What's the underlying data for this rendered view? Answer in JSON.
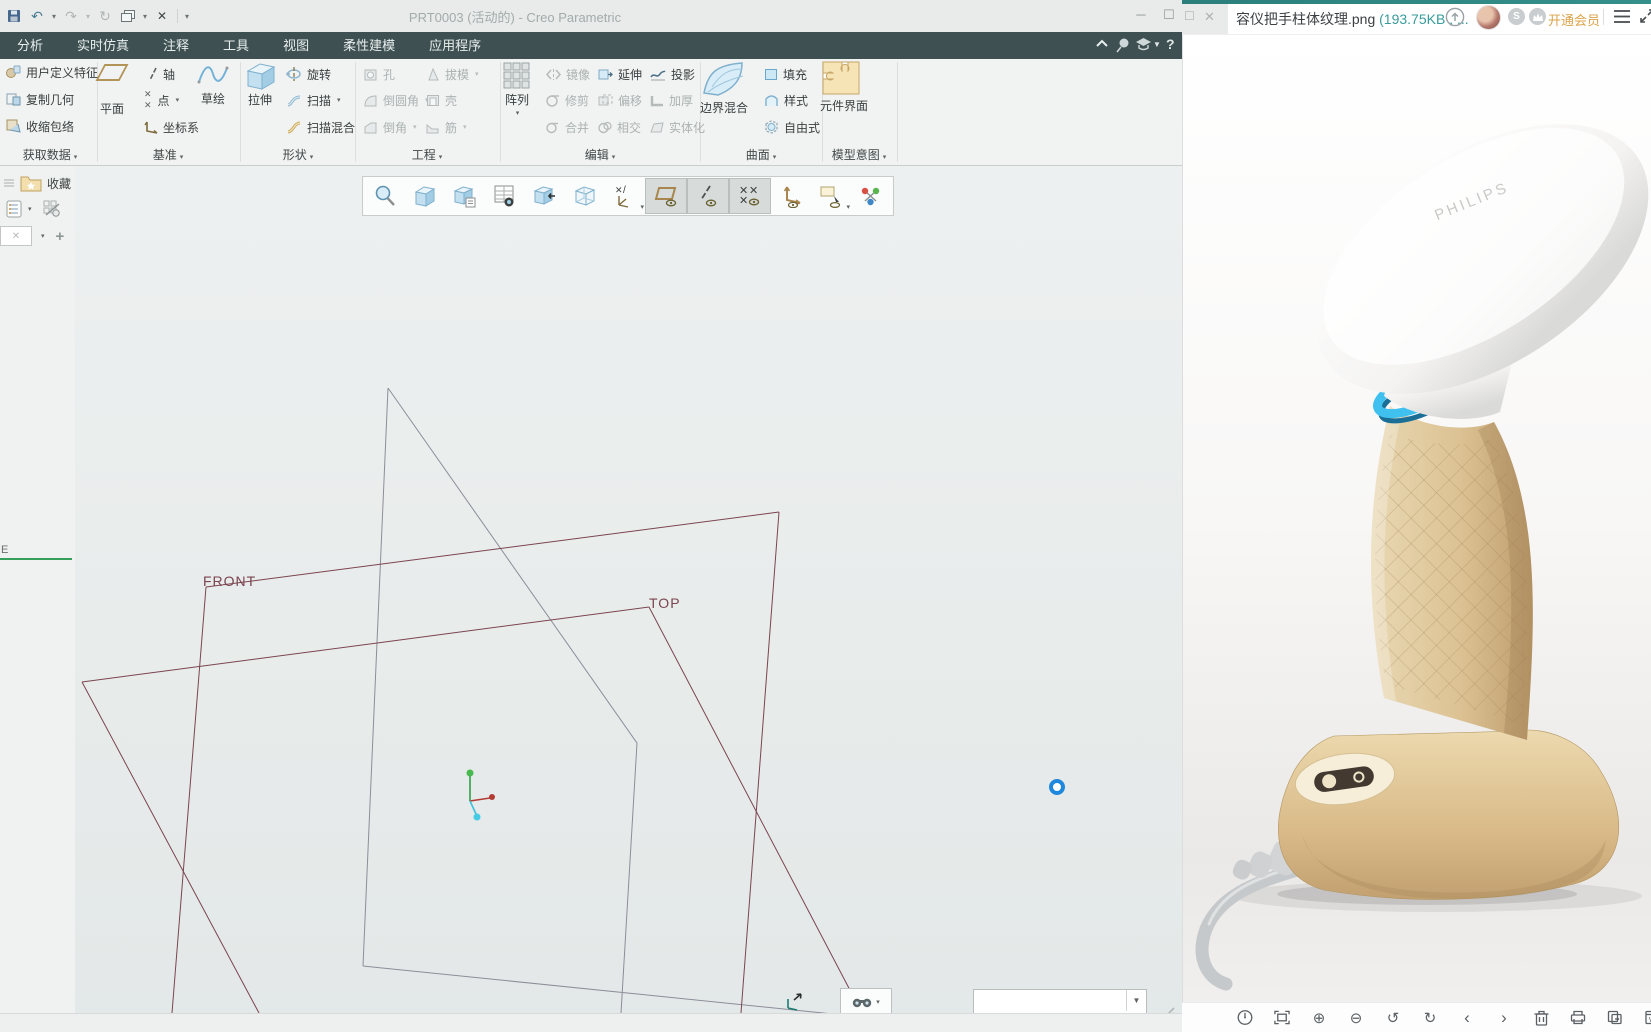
{
  "creo": {
    "title": "PRT0003 (活动的) - Creo Parametric",
    "tabs": [
      "分析",
      "实时仿真",
      "注释",
      "工具",
      "视图",
      "柔性建模",
      "应用程序"
    ],
    "qat_icons": [
      "save-icon",
      "undo-icon",
      "undo-dropdown",
      "redo-icon",
      "redo-dropdown",
      "regenerate-icon",
      "windows-icon",
      "windows-dropdown",
      "close-window-icon",
      "customize-dropdown"
    ],
    "tabbar_icons": [
      "minimize-ribbon-icon",
      "command-search-icon",
      "learning-icon",
      "dropdown-icon",
      "help-icon"
    ],
    "ribbon": {
      "groups": [
        {
          "label": "获取数据",
          "items": [
            {
              "label": "用户定义特征"
            },
            {
              "label": "复制几何"
            },
            {
              "label": "收缩包络"
            }
          ]
        },
        {
          "label": "基准",
          "items": [
            {
              "label": "平面"
            },
            {
              "label": "轴"
            },
            {
              "label": "点"
            },
            {
              "label": "坐标系"
            },
            {
              "label": "草绘"
            }
          ]
        },
        {
          "label": "形状",
          "items": [
            {
              "label": "拉伸"
            },
            {
              "label": "旋转"
            },
            {
              "label": "扫描"
            },
            {
              "label": "扫描混合"
            }
          ]
        },
        {
          "label": "工程",
          "items": [
            {
              "label": "孔"
            },
            {
              "label": "拔模"
            },
            {
              "label": "倒圆角"
            },
            {
              "label": "壳"
            },
            {
              "label": "倒角"
            },
            {
              "label": "筋"
            }
          ]
        },
        {
          "label": "编辑",
          "items": [
            {
              "label": "阵列"
            },
            {
              "label": "镜像"
            },
            {
              "label": "延伸"
            },
            {
              "label": "投影"
            },
            {
              "label": "修剪"
            },
            {
              "label": "偏移"
            },
            {
              "label": "加厚"
            },
            {
              "label": "合并"
            },
            {
              "label": "相交"
            },
            {
              "label": "实体化"
            }
          ]
        },
        {
          "label": "曲面",
          "items": [
            {
              "label": "边界混合"
            },
            {
              "label": "填充"
            },
            {
              "label": "样式"
            },
            {
              "label": "自由式"
            }
          ]
        },
        {
          "label": "模型意图",
          "items": [
            {
              "label": "元件界面"
            }
          ]
        }
      ]
    },
    "left_panel": {
      "favorites": "收藏",
      "fragment": "E"
    },
    "canvas": {
      "front_label": "FRONT",
      "top_label": "TOP"
    },
    "graphics_toolbar_icons": [
      "zoom-icon",
      "refit-icon",
      "saved-views-icon",
      "view-manager-icon",
      "view-normal-icon",
      "display-style-icon",
      "datum-filter-icon",
      "plane-display-toggle",
      "axis-display-toggle",
      "point-display-toggle",
      "csys-display-toggle",
      "annotation-display-icon",
      "spin-center-icon"
    ],
    "graphics_toolbar_pressed": [
      "plane-display-toggle",
      "axis-display-toggle",
      "point-display-toggle"
    ],
    "status_icons": [
      "drag-handle-icon",
      "find-icon",
      "filter-combobox",
      "resize-grip-icon"
    ]
  },
  "viewer": {
    "filename": "容仪把手柱体纹理.png",
    "filesize": "(193.75KB , ...",
    "member": "开通会员",
    "brand": "PHILIPS",
    "topbar_icons": [
      "maximize-icon",
      "close-icon",
      "cloud-upload-icon",
      "avatar",
      "coin-badge-icon",
      "crown-badge-icon",
      "menu-icon",
      "expand-icon"
    ],
    "toolbar_icons": [
      "actual-size-icon",
      "fit-window-icon",
      "zoom-in-icon",
      "zoom-out-icon",
      "rotate-left-icon",
      "rotate-right-icon",
      "previous-icon",
      "next-icon",
      "delete-icon",
      "print-icon",
      "copy-pages-icon",
      "doc-extract-icon"
    ]
  },
  "colors": {
    "tabbar": "#3E5051",
    "ribbon_bg": "#F1F3F2",
    "accent_teal": "#2F8B8B",
    "member_gold": "#DBA34A",
    "plane_line_maroon": "#7B4450",
    "plane_line_grey": "#8D8D99",
    "blue_ring": "#3FC0EE",
    "handle_tan": "#D8C19A",
    "spin_dot_blue": "#1F87DC"
  }
}
